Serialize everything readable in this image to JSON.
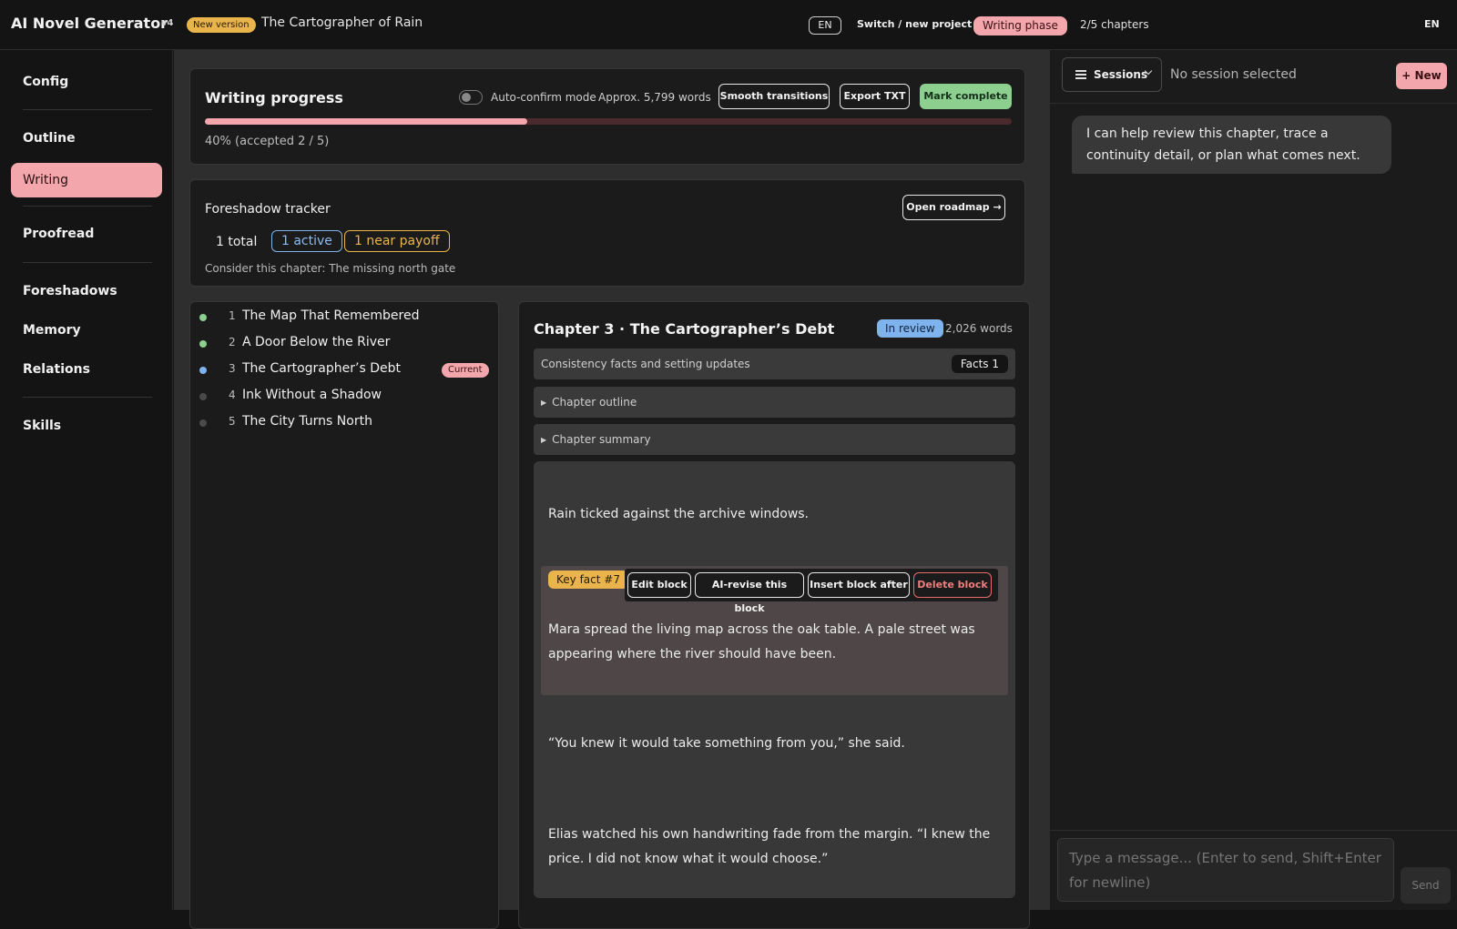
{
  "app": {
    "title": "AI Novel Generator",
    "version": "v4",
    "new_version_badge": "New version",
    "project_name": "The Cartographer of Rain",
    "lang_pill": "EN",
    "switch_project": "Switch / new project",
    "phase": "Writing phase",
    "chapter_count": "2/5 chapters",
    "lang_right": "EN"
  },
  "sidebar": {
    "items": [
      "Config",
      "Outline",
      "Writing",
      "Proofread",
      "Foreshadows",
      "Memory",
      "Relations",
      "Skills"
    ],
    "active": "Writing"
  },
  "progress": {
    "title": "Writing progress",
    "auto_confirm": "Auto-confirm mode",
    "word_approx": "Approx. 5,799 words",
    "smooth_btn": "Smooth transitions",
    "export_btn": "Export TXT",
    "complete_btn": "Mark complete",
    "percent": 40,
    "text": "40% (accepted 2 / 5)"
  },
  "foreshadow": {
    "title": "Foreshadow tracker",
    "open_btn": "Open roadmap →",
    "total": "1 total",
    "active": "1 active",
    "near_payoff": "1 near payoff",
    "consider": "Consider this chapter: The missing north gate"
  },
  "chapters": [
    {
      "num": "1",
      "title": "The Map That Remembered",
      "status_color": "#8ccf8f"
    },
    {
      "num": "2",
      "title": "A Door Below the River",
      "status_color": "#8ccf8f"
    },
    {
      "num": "3",
      "title": "The Cartographer’s Debt",
      "status_color": "#7fb3ee",
      "current": "Current"
    },
    {
      "num": "4",
      "title": "Ink Without a Shadow",
      "status_color": "#4a4a4a"
    },
    {
      "num": "5",
      "title": "The City Turns North",
      "status_color": "#4a4a4a"
    }
  ],
  "editor": {
    "title": "Chapter 3 · The Cartographer’s Debt",
    "status": "In review",
    "words": "2,026 words",
    "consistency": "Consistency facts and setting updates",
    "facts_badge": "Facts 1",
    "outline": "Chapter outline",
    "summary": "Chapter summary",
    "para1": "Rain ticked against the archive windows.",
    "keyfact": "Key fact #7",
    "edit_btn": "Edit block",
    "revise_btn": "AI-revise this block",
    "insert_btn": "Insert block after",
    "delete_btn": "Delete block",
    "para2": "Mara spread the living map across the oak table. A pale street was appearing where the river should have been.",
    "para3": "“You knew it would take something from you,” she said.",
    "para4": "Elias watched his own handwriting fade from the margin. “I knew the price. I did not know what it would choose.”"
  },
  "chat": {
    "sessions_btn": "Sessions",
    "no_session": "No session selected",
    "new_btn": "+ New",
    "bubble": "I can help review this chapter, trace a continuity detail, or plan what comes next.",
    "input_placeholder": "Type a message... (Enter to send, Shift+Enter for newline)",
    "send_btn": "Send"
  }
}
